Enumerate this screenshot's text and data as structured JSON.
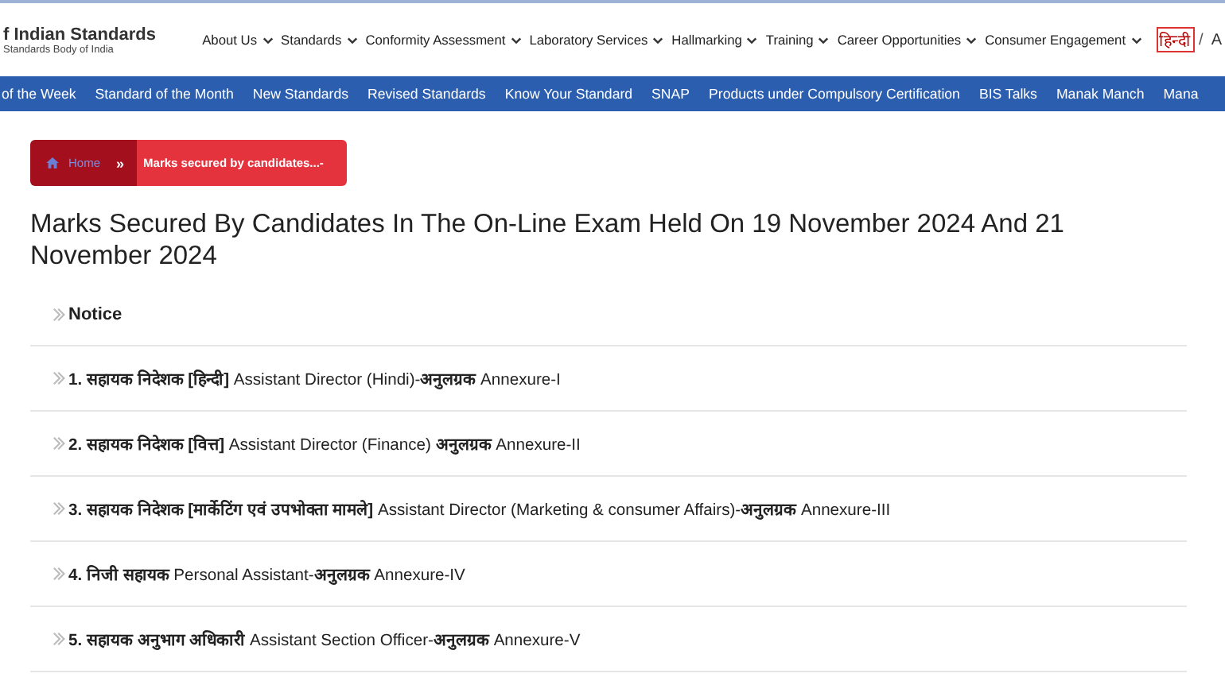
{
  "header": {
    "logo_title": "f Indian Standards",
    "logo_subtitle": "Standards Body of India",
    "menu": [
      "About Us",
      "Standards",
      "Conformity Assessment",
      "Laboratory Services",
      "Hallmarking",
      "Training",
      "Career Opportunities",
      "Consumer Engagement"
    ],
    "languages": [
      {
        "label": "हिन्दी",
        "selected": true
      },
      {
        "label": "A",
        "selected": false
      }
    ],
    "language_separator": "/"
  },
  "nav_bar": [
    "of the Week",
    "Standard of the Month",
    "New Standards",
    "Revised Standards",
    "Know Your Standard",
    "SNAP",
    "Products under Compulsory Certification",
    "BIS Talks",
    "Manak Manch",
    "Mana"
  ],
  "breadcrumb": {
    "home": "Home",
    "separator": "»",
    "current": "Marks secured by candidates...-"
  },
  "title": "Marks Secured By Candidates In The On-Line Exam Held On 19 November 2024 And 21 November 2024",
  "items": [
    {
      "kind": "heading",
      "text": "**Notice**"
    },
    {
      "kind": "link",
      "text": "**1. सहायक निदेशक [हिन्दी]** Assistant Director (Hindi)-**अनुलग्रक** Annexure-I"
    },
    {
      "kind": "link",
      "text": "**2. सहायक निदेशक [वित्त]** Assistant Director (Finance) **अनुलग्रक** Annexure-II"
    },
    {
      "kind": "link",
      "text": "**3. सहायक निदेशक [मार्केटिंग एवं उपभोक्ता मामले]** Assistant Director (Marketing & consumer Affairs)-**अनुलग्रक** Annexure-III"
    },
    {
      "kind": "link",
      "text": "**4. निजी सहायक** Personal Assistant-**अनुलग्रक** Annexure-IV"
    },
    {
      "kind": "link",
      "text": "**5. सहायक अनुभाग अधिकारी** Assistant Section Officer-**अनुलग्रक** Annexure-V"
    }
  ]
}
